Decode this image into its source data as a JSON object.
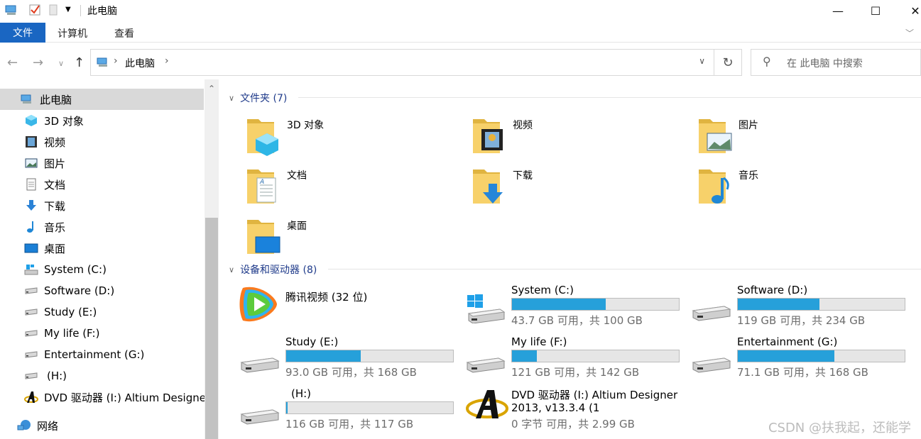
{
  "window": {
    "title": "此电脑",
    "minimize": "—",
    "maximize": "☐",
    "close": "✕"
  },
  "ribbon": {
    "tabs": [
      "文件",
      "计算机",
      "查看"
    ]
  },
  "address": {
    "path": "此电脑",
    "search_placeholder": "在 此电脑 中搜索"
  },
  "nav": {
    "items": [
      {
        "label": "此电脑",
        "icon": "computer-icon",
        "selected": true
      },
      {
        "label": "3D 对象",
        "icon": "3d-objects-icon"
      },
      {
        "label": "视频",
        "icon": "video-icon"
      },
      {
        "label": "图片",
        "icon": "pictures-icon"
      },
      {
        "label": "文档",
        "icon": "documents-icon"
      },
      {
        "label": "下载",
        "icon": "download-icon"
      },
      {
        "label": "音乐",
        "icon": "music-icon"
      },
      {
        "label": "桌面",
        "icon": "desktop-icon"
      },
      {
        "label": "System (C:)",
        "icon": "windows-drive-icon"
      },
      {
        "label": "Software (D:)",
        "icon": "drive-icon"
      },
      {
        "label": "Study (E:)",
        "icon": "drive-icon"
      },
      {
        "label": "My life (F:)",
        "icon": "drive-icon"
      },
      {
        "label": "Entertainment (G:)",
        "icon": "drive-icon"
      },
      {
        "label": "(H:)",
        "icon": "drive-icon"
      },
      {
        "label": "DVD 驱动器 (I:) Altium Designer",
        "icon": "altium-icon"
      },
      {
        "label": "网络",
        "icon": "network-icon"
      }
    ]
  },
  "folders_group": {
    "title": "文件夹 (7)",
    "items": [
      {
        "label": "3D 对象",
        "overlay": "cube"
      },
      {
        "label": "视频",
        "overlay": "film"
      },
      {
        "label": "图片",
        "overlay": "picture"
      },
      {
        "label": "文档",
        "overlay": "document"
      },
      {
        "label": "下载",
        "overlay": "arrow"
      },
      {
        "label": "音乐",
        "overlay": "note"
      },
      {
        "label": "桌面",
        "overlay": "desktop"
      }
    ]
  },
  "drives_group": {
    "title": "设备和驱动器 (8)",
    "app": {
      "label": "腾讯视频 (32 位)"
    },
    "drives": [
      {
        "name": "System (C:)",
        "info": "43.7 GB 可用，共 100 GB",
        "used_fraction": 0.563,
        "icon": "windows"
      },
      {
        "name": "Software (D:)",
        "info": "119 GB 可用，共 234 GB",
        "used_fraction": 0.491,
        "icon": "drive"
      },
      {
        "name": "Study (E:)",
        "info": "93.0 GB 可用，共 168 GB",
        "used_fraction": 0.446,
        "icon": "drive"
      },
      {
        "name": "My life (F:)",
        "info": "121 GB 可用，共 142 GB",
        "used_fraction": 0.148,
        "icon": "drive"
      },
      {
        "name": "Entertainment (G:)",
        "info": "71.1 GB 可用，共 168 GB",
        "used_fraction": 0.577,
        "icon": "drive"
      },
      {
        "name": "(H:)",
        "info": "116 GB 可用，共 117 GB",
        "used_fraction": 0.009,
        "icon": "drive"
      }
    ],
    "dvd": {
      "name_line1": "DVD 驱动器 (I:) Altium Designer",
      "name_line2": "2013, v13.3.4 (1",
      "info": "0 字节 可用，共 2.99 GB"
    }
  },
  "watermark": "CSDN @扶我起，还能学",
  "colors": {
    "accent": "#1a66c2",
    "bar_fill": "#26a0da",
    "group_header": "#1e3a8a",
    "folder": "#f5c542"
  }
}
